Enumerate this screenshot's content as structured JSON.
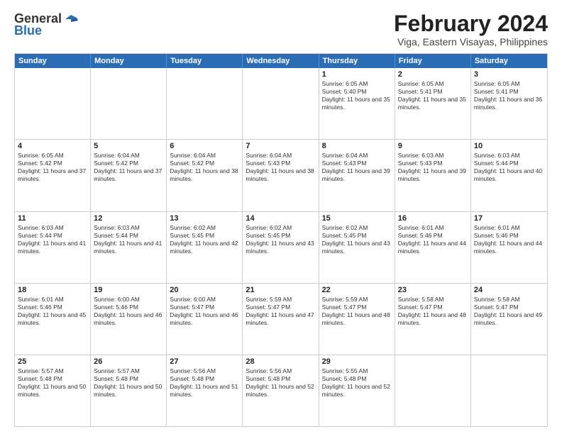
{
  "logo": {
    "general": "General",
    "blue": "Blue"
  },
  "title": "February 2024",
  "subtitle": "Viga, Eastern Visayas, Philippines",
  "headers": [
    "Sunday",
    "Monday",
    "Tuesday",
    "Wednesday",
    "Thursday",
    "Friday",
    "Saturday"
  ],
  "weeks": [
    [
      {
        "day": "",
        "sunrise": "",
        "sunset": "",
        "daylight": ""
      },
      {
        "day": "",
        "sunrise": "",
        "sunset": "",
        "daylight": ""
      },
      {
        "day": "",
        "sunrise": "",
        "sunset": "",
        "daylight": ""
      },
      {
        "day": "",
        "sunrise": "",
        "sunset": "",
        "daylight": ""
      },
      {
        "day": "1",
        "sunrise": "Sunrise: 6:05 AM",
        "sunset": "Sunset: 5:40 PM",
        "daylight": "Daylight: 11 hours and 35 minutes."
      },
      {
        "day": "2",
        "sunrise": "Sunrise: 6:05 AM",
        "sunset": "Sunset: 5:41 PM",
        "daylight": "Daylight: 11 hours and 35 minutes."
      },
      {
        "day": "3",
        "sunrise": "Sunrise: 6:05 AM",
        "sunset": "Sunset: 5:41 PM",
        "daylight": "Daylight: 11 hours and 36 minutes."
      }
    ],
    [
      {
        "day": "4",
        "sunrise": "Sunrise: 6:05 AM",
        "sunset": "Sunset: 5:42 PM",
        "daylight": "Daylight: 11 hours and 37 minutes."
      },
      {
        "day": "5",
        "sunrise": "Sunrise: 6:04 AM",
        "sunset": "Sunset: 5:42 PM",
        "daylight": "Daylight: 11 hours and 37 minutes."
      },
      {
        "day": "6",
        "sunrise": "Sunrise: 6:04 AM",
        "sunset": "Sunset: 5:42 PM",
        "daylight": "Daylight: 11 hours and 38 minutes."
      },
      {
        "day": "7",
        "sunrise": "Sunrise: 6:04 AM",
        "sunset": "Sunset: 5:43 PM",
        "daylight": "Daylight: 11 hours and 38 minutes."
      },
      {
        "day": "8",
        "sunrise": "Sunrise: 6:04 AM",
        "sunset": "Sunset: 5:43 PM",
        "daylight": "Daylight: 11 hours and 39 minutes."
      },
      {
        "day": "9",
        "sunrise": "Sunrise: 6:03 AM",
        "sunset": "Sunset: 5:43 PM",
        "daylight": "Daylight: 11 hours and 39 minutes."
      },
      {
        "day": "10",
        "sunrise": "Sunrise: 6:03 AM",
        "sunset": "Sunset: 5:44 PM",
        "daylight": "Daylight: 11 hours and 40 minutes."
      }
    ],
    [
      {
        "day": "11",
        "sunrise": "Sunrise: 6:03 AM",
        "sunset": "Sunset: 5:44 PM",
        "daylight": "Daylight: 11 hours and 41 minutes."
      },
      {
        "day": "12",
        "sunrise": "Sunrise: 6:03 AM",
        "sunset": "Sunset: 5:44 PM",
        "daylight": "Daylight: 11 hours and 41 minutes."
      },
      {
        "day": "13",
        "sunrise": "Sunrise: 6:02 AM",
        "sunset": "Sunset: 5:45 PM",
        "daylight": "Daylight: 11 hours and 42 minutes."
      },
      {
        "day": "14",
        "sunrise": "Sunrise: 6:02 AM",
        "sunset": "Sunset: 5:45 PM",
        "daylight": "Daylight: 11 hours and 43 minutes."
      },
      {
        "day": "15",
        "sunrise": "Sunrise: 6:02 AM",
        "sunset": "Sunset: 5:45 PM",
        "daylight": "Daylight: 11 hours and 43 minutes."
      },
      {
        "day": "16",
        "sunrise": "Sunrise: 6:01 AM",
        "sunset": "Sunset: 5:46 PM",
        "daylight": "Daylight: 11 hours and 44 minutes."
      },
      {
        "day": "17",
        "sunrise": "Sunrise: 6:01 AM",
        "sunset": "Sunset: 5:46 PM",
        "daylight": "Daylight: 11 hours and 44 minutes."
      }
    ],
    [
      {
        "day": "18",
        "sunrise": "Sunrise: 6:01 AM",
        "sunset": "Sunset: 5:46 PM",
        "daylight": "Daylight: 11 hours and 45 minutes."
      },
      {
        "day": "19",
        "sunrise": "Sunrise: 6:00 AM",
        "sunset": "Sunset: 5:46 PM",
        "daylight": "Daylight: 11 hours and 46 minutes."
      },
      {
        "day": "20",
        "sunrise": "Sunrise: 6:00 AM",
        "sunset": "Sunset: 5:47 PM",
        "daylight": "Daylight: 11 hours and 46 minutes."
      },
      {
        "day": "21",
        "sunrise": "Sunrise: 5:59 AM",
        "sunset": "Sunset: 5:47 PM",
        "daylight": "Daylight: 11 hours and 47 minutes."
      },
      {
        "day": "22",
        "sunrise": "Sunrise: 5:59 AM",
        "sunset": "Sunset: 5:47 PM",
        "daylight": "Daylight: 11 hours and 48 minutes."
      },
      {
        "day": "23",
        "sunrise": "Sunrise: 5:58 AM",
        "sunset": "Sunset: 5:47 PM",
        "daylight": "Daylight: 11 hours and 48 minutes."
      },
      {
        "day": "24",
        "sunrise": "Sunrise: 5:58 AM",
        "sunset": "Sunset: 5:47 PM",
        "daylight": "Daylight: 11 hours and 49 minutes."
      }
    ],
    [
      {
        "day": "25",
        "sunrise": "Sunrise: 5:57 AM",
        "sunset": "Sunset: 5:48 PM",
        "daylight": "Daylight: 11 hours and 50 minutes."
      },
      {
        "day": "26",
        "sunrise": "Sunrise: 5:57 AM",
        "sunset": "Sunset: 5:48 PM",
        "daylight": "Daylight: 11 hours and 50 minutes."
      },
      {
        "day": "27",
        "sunrise": "Sunrise: 5:56 AM",
        "sunset": "Sunset: 5:48 PM",
        "daylight": "Daylight: 11 hours and 51 minutes."
      },
      {
        "day": "28",
        "sunrise": "Sunrise: 5:56 AM",
        "sunset": "Sunset: 5:48 PM",
        "daylight": "Daylight: 11 hours and 52 minutes."
      },
      {
        "day": "29",
        "sunrise": "Sunrise: 5:55 AM",
        "sunset": "Sunset: 5:48 PM",
        "daylight": "Daylight: 11 hours and 52 minutes."
      },
      {
        "day": "",
        "sunrise": "",
        "sunset": "",
        "daylight": ""
      },
      {
        "day": "",
        "sunrise": "",
        "sunset": "",
        "daylight": ""
      }
    ]
  ]
}
